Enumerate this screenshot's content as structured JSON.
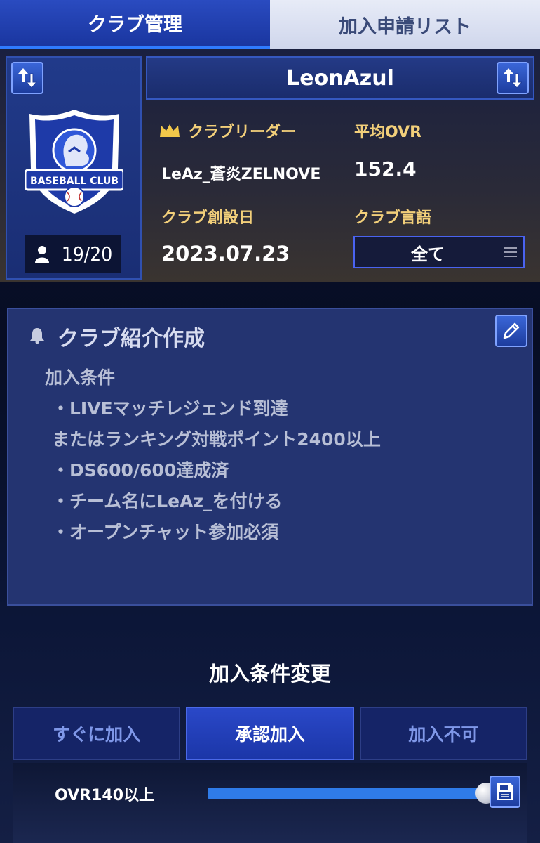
{
  "tabs": [
    {
      "label": "クラブ管理",
      "active": true
    },
    {
      "label": "加入申請リスト",
      "active": false
    }
  ],
  "club": {
    "name": "LeonAzul",
    "emblem_text": "BASEBALL CLUB",
    "members": "19/20",
    "leader_label": "クラブリーダー",
    "leader_value": "LeAz_蒼炎ZELNOVE",
    "avg_ovr_label": "平均OVR",
    "avg_ovr_value": "152.4",
    "founded_label": "クラブ創設日",
    "founded_value": "2023.07.23",
    "language_label": "クラブ言語",
    "language_value": "全て"
  },
  "intro": {
    "title": "クラブ紹介作成",
    "lines": [
      "加入条件",
      "・LIVEマッチレジェンド到達",
      "またはランキング対戦ポイント2400以上",
      "・DS600/600達成済",
      "・チーム名にLeAz_を付ける",
      "・オープンチャット参加必須"
    ]
  },
  "conditions": {
    "title": "加入条件変更",
    "options": [
      {
        "label": "すぐに加入",
        "selected": false
      },
      {
        "label": "承認加入",
        "selected": true
      },
      {
        "label": "加入不可",
        "selected": false
      }
    ],
    "ovr_label": "OVR140以上",
    "ovr_slider_fraction": 1.0
  },
  "icons": {
    "swap": "swap-arrows-icon",
    "crown": "crown-icon",
    "person": "person-icon",
    "bell": "bell-icon",
    "edit": "pencil-icon",
    "save": "floppy-disk-icon",
    "menu": "hamburger-menu-icon"
  },
  "colors": {
    "accent_blue": "#2f7bff",
    "gold_label": "#f2cf7a"
  }
}
